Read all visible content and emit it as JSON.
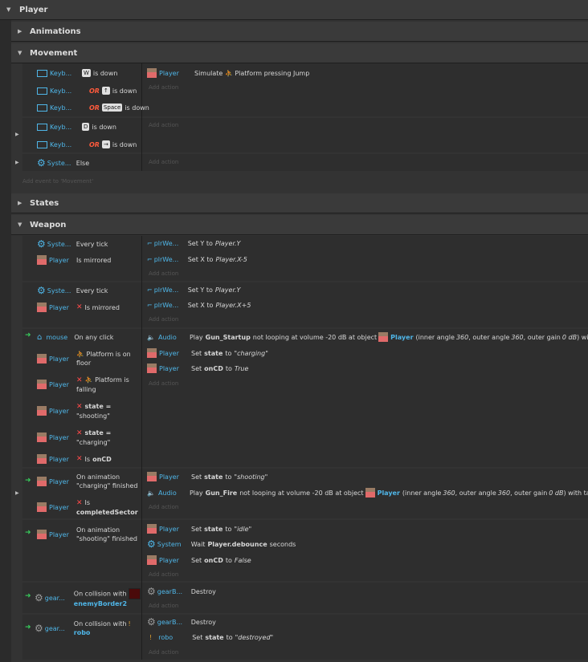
{
  "groups": {
    "player": "Player",
    "animations": "Animations",
    "movement": "Movement",
    "states": "States",
    "weapon": "Weapon"
  },
  "common": {
    "add_action": "Add action",
    "add_event": "Add event to 'Movement'",
    "player": "Player",
    "keyb": "Keyb...",
    "syste": "Syste...",
    "system": "System",
    "plrwe": "plrWe...",
    "mouse": "mouse",
    "audio": "Audio",
    "gear": "gear...",
    "gearB": "gearB...",
    "robo": "robo",
    "or": "OR"
  },
  "movement": {
    "c1_key": "W",
    "c1_text": "is down",
    "c2_key": "↑",
    "c2_text": "is down",
    "c3_key": "Space",
    "c3_text": "is down",
    "a1_pre": "Simulate",
    "a1_post": "Platform pressing Jump",
    "c4_key": "D",
    "c4_text": "is down",
    "c5_key": "→",
    "c5_text": "is down",
    "c6_text": "Else"
  },
  "weapon": {
    "e1": {
      "c1": "Every tick",
      "c2": "Is mirrored",
      "a1_pre": "Set Y to",
      "a1_val": "Player.Y",
      "a2_pre": "Set X to",
      "a2_val": "Player.X-5"
    },
    "e2": {
      "c1": "Every tick",
      "c2": "Is mirrored",
      "a1_pre": "Set Y to",
      "a1_val": "Player.Y",
      "a2_pre": "Set X to",
      "a2_val": "Player.X+5"
    },
    "e3": {
      "c1": "On any click",
      "c2_a": "Platform is on",
      "c2_b": "floor",
      "c3_a": "Platform is",
      "c3_b": "falling",
      "c4_a": "state =",
      "c4_b": "\"shooting\"",
      "c5_a": "state =",
      "c5_b": "\"charging\"",
      "c6_pre": "Is",
      "c6_b": "onCD",
      "a1": {
        "pre": "Play",
        "name": "Gun_Startup",
        "mid": "not looping at volume -20 dB at object",
        "obj": "Player",
        "p1": "(inner angle",
        "v1": "360",
        "p2": ", outer angle",
        "v2": "360",
        "p3": ", outer gain",
        "v3": "0 dB",
        "p4": ") with tag \"\""
      },
      "a2_pre": "Set",
      "a2_b": "state",
      "a2_mid": "to",
      "a2_val": "\"charging\"",
      "a3_pre": "Set",
      "a3_b": "onCD",
      "a3_mid": "to",
      "a3_val": "True"
    },
    "e4": {
      "c1_a": "On animation",
      "c1_b": "\"charging\" finished",
      "c2_a": "Is",
      "c2_b": "completedSector",
      "a1_pre": "Set",
      "a1_b": "state",
      "a1_mid": "to",
      "a1_val": "\"shooting\"",
      "a2": {
        "pre": "Play",
        "name": "Gun_Fire",
        "mid": "not looping at volume -20 dB at object",
        "obj": "Player",
        "p1": "(inner angle",
        "v1": "360",
        "p2": ", outer angle",
        "v2": "360",
        "p3": ", outer gain",
        "v3": "0 dB",
        "p4": ") with tag \"\""
      }
    },
    "e5": {
      "c1_a": "On animation",
      "c1_b": "\"shooting\" finished",
      "a1_pre": "Set",
      "a1_b": "state",
      "a1_mid": "to",
      "a1_val": "\"idle\"",
      "a2_pre": "Wait",
      "a2_b": "Player.debounce",
      "a2_post": "seconds",
      "a3_pre": "Set",
      "a3_b": "onCD",
      "a3_mid": "to",
      "a3_val": "False"
    },
    "e6": {
      "c1_a": "On collision with",
      "c1_b": "enemyBorder2",
      "a1": "Destroy"
    },
    "e7": {
      "c1_a": "On collision with",
      "c1_b": "robo",
      "a1": "Destroy",
      "a2_pre": "Set",
      "a2_b": "state",
      "a2_mid": "to",
      "a2_val": "\"destroyed\""
    }
  },
  "colors": {
    "object_link": "#4fb6e8",
    "or": "#ff5a3c",
    "trigger_arrow": "#37c85a",
    "invert": "#ff4a4a"
  }
}
